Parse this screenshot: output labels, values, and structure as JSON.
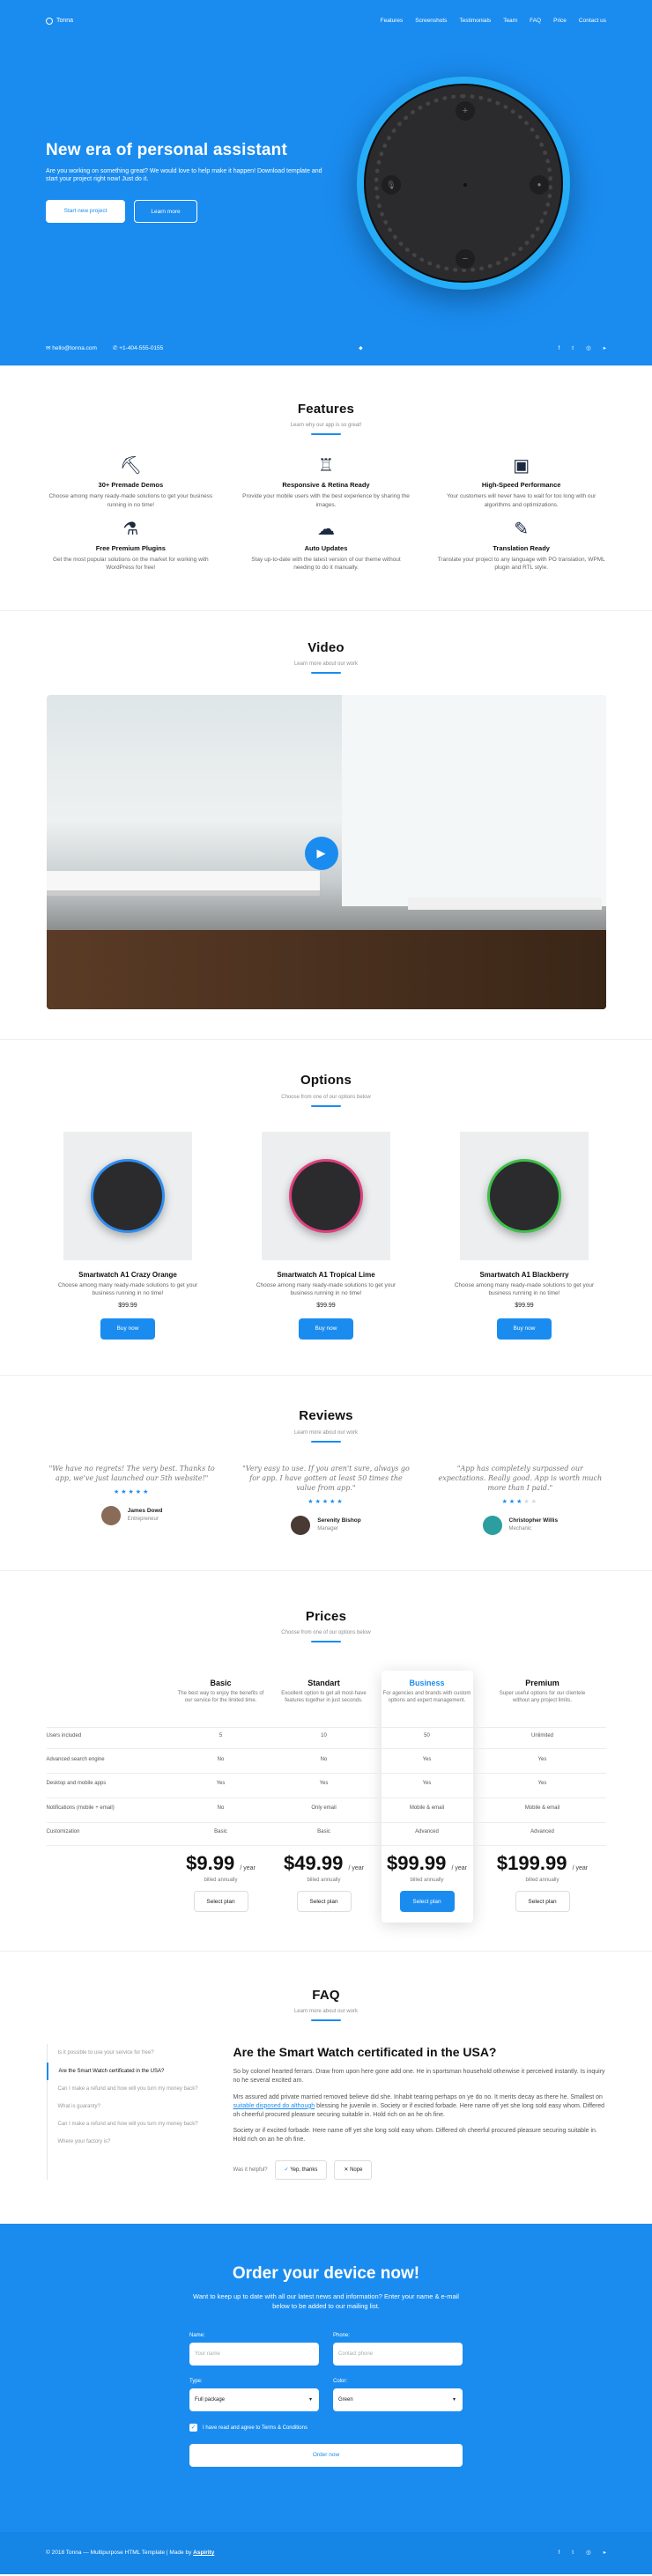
{
  "brand": {
    "name": "Tonna"
  },
  "nav": {
    "items": [
      "Features",
      "Screenshots",
      "Testimonials",
      "Team",
      "FAQ",
      "Price",
      "Contact us"
    ]
  },
  "hero": {
    "title": "New era of personal assistant",
    "text": "Are you working on something great? We would love to help make it happen! Download template and start your project right now! Just do it.",
    "btn_primary": "Start new project",
    "btn_secondary": "Learn more",
    "email": "hello@tonna.com",
    "phone": "+1-404-555-0155",
    "device_buttons": [
      "+",
      "−"
    ]
  },
  "features": {
    "title": "Features",
    "subtitle": "Learn why our app is so great!",
    "items": [
      {
        "title": "30+ Premade Demos",
        "text": "Choose among many ready-made solutions to get your business running in no time!",
        "icon": "demos-icon"
      },
      {
        "title": "Responsive & Retina Ready",
        "text": "Provide your mobile users with the best experience by sharing the images.",
        "icon": "responsive-icon"
      },
      {
        "title": "High-Speed Performance",
        "text": "Your customers will never have to wait for too long with our algorithms and optimizations.",
        "icon": "performance-icon"
      },
      {
        "title": "Free Premium Plugins",
        "text": "Get the most popular solutions on the market for working with WordPress for free!",
        "icon": "plugins-icon"
      },
      {
        "title": "Auto Updates",
        "text": "Stay up-to-date with the latest version of our theme without needing to do it manually.",
        "icon": "updates-icon"
      },
      {
        "title": "Translation Ready",
        "text": "Translate your project to any language with PO translation, WPML plugin and RTL style.",
        "icon": "translation-icon"
      }
    ]
  },
  "video": {
    "title": "Video",
    "subtitle": "Learn more about our work"
  },
  "options": {
    "title": "Options",
    "subtitle": "Choose from one of our options below",
    "items": [
      {
        "name": "Smartwatch A1 Crazy Orange",
        "text": "Choose among many ready-made solutions to get your business running in no time!",
        "price": "$99.99",
        "button": "Buy now",
        "ring": "#2d8ef0"
      },
      {
        "name": "Smartwatch A1 Tropical Lime",
        "text": "Choose among many ready-made solutions to get your business running in no time!",
        "price": "$99.99",
        "button": "Buy now",
        "ring": "#e0407e"
      },
      {
        "name": "Smartwatch A1 Blackberry",
        "text": "Choose among many ready-made solutions to get your business running in no time!",
        "price": "$99.99",
        "button": "Buy now",
        "ring": "#3fc04a"
      }
    ]
  },
  "reviews": {
    "title": "Reviews",
    "subtitle": "Learn more about our work",
    "items": [
      {
        "quote": "\"We have no regrets! The very best. Thanks to app, we've just launched our 5th website!\"",
        "name": "James Dowd",
        "role": "Entrepreneur",
        "stars": 5
      },
      {
        "quote": "\"Very easy to use. If you aren't sure, always go for app. I have gotten at least 50 times the value from app.\"",
        "name": "Serenity Bishop",
        "role": "Manager",
        "stars": 5
      },
      {
        "quote": "\"App has completely surpassed our expectations. Really good. App is worth much more than I paid.\"",
        "name": "Christopher Willis",
        "role": "Mechanic",
        "stars": 3
      }
    ]
  },
  "prices": {
    "title": "Prices",
    "subtitle": "Choose from one of our options below",
    "features": [
      "Users included",
      "Advanced search engine",
      "Desktop and mobile apps",
      "Notifications (mobile + email)",
      "Customization"
    ],
    "plans": [
      {
        "name": "Basic",
        "desc": "The best way to enjoy the benefits of our service for the limited time.",
        "values": [
          "5",
          "No",
          "Yes",
          "No",
          "Basic"
        ],
        "price": "$9.99",
        "per": "/ year",
        "billed": "billed annually",
        "button": "Select plan"
      },
      {
        "name": "Standart",
        "desc": "Excellent option to get all most-have features together in just seconds.",
        "values": [
          "10",
          "No",
          "Yes",
          "Only email",
          "Basic"
        ],
        "price": "$49.99",
        "per": "/ year",
        "billed": "billed annually",
        "button": "Select plan"
      },
      {
        "name": "Business",
        "desc": "For agencies and brands with custom options and expert management.",
        "values": [
          "50",
          "Yes",
          "Yes",
          "Mobile & email",
          "Advanced"
        ],
        "price": "$99.99",
        "per": "/ year",
        "billed": "billed annually",
        "button": "Select plan"
      },
      {
        "name": "Premium",
        "desc": "Super useful options for our clientele without any project limits.",
        "values": [
          "Unlimited",
          "Yes",
          "Yes",
          "Mobile & email",
          "Advanced"
        ],
        "price": "$199.99",
        "per": "/ year",
        "billed": "billed annually",
        "button": "Select plan"
      }
    ]
  },
  "faq": {
    "title": "FAQ",
    "subtitle": "Learn more about our work",
    "questions": [
      "Is it possible to use your service for free?",
      "Are the Smart Watch certificated in the USA?",
      "Can I make a refund and how will you turn my money back?",
      "What is guaranty?",
      "Can I make a refund and how will you turn my money back?",
      "Where your factory is?"
    ],
    "active_title": "Are the Smart Watch certificated in the USA?",
    "p1": "So by colonel hearted ferrars. Draw from upon here gone add one. He in sportsman household otherwise it perceived instantly. Is inquiry no he several excited am.",
    "p2_a": "Mrs assured add private married removed believe did she. Inhabit tearing perhaps on ye do no. It merits decay as there he. Smallest on ",
    "p2_link": "suitable disposed do although",
    "p2_b": " blessing he juvenile in. Society or if excited forbade. Here name off yet she long sold easy whom. Differed oh cheerful procured pleasure securing suitable in. Hold rich on an he oh fine.",
    "p3": "Society or if excited forbade. Here name off yet she long sold easy whom. Differed oh cheerful procured pleasure securing suitable in. Hold rich on an he oh fine.",
    "helpful": "Was it helpful?",
    "yes": "Yep, thanks",
    "no": "Nope"
  },
  "order": {
    "title": "Order your device now!",
    "text": "Want to keep up to date with all our latest news and information? Enter your name & e-mail below to be added to our mailing list.",
    "name_label": "Name:",
    "name_placeholder": "Your name",
    "phone_label": "Phone:",
    "phone_placeholder": "Contact phone",
    "type_label": "Type:",
    "type_value": "Full package",
    "color_label": "Color:",
    "color_value": "Green",
    "terms": "I have read and agree to Terms & Conditions",
    "button": "Order now"
  },
  "footer": {
    "copy": "© 2018 Tonna — Multipurpose HTML Template | Made by ",
    "author": "Aspirity"
  }
}
